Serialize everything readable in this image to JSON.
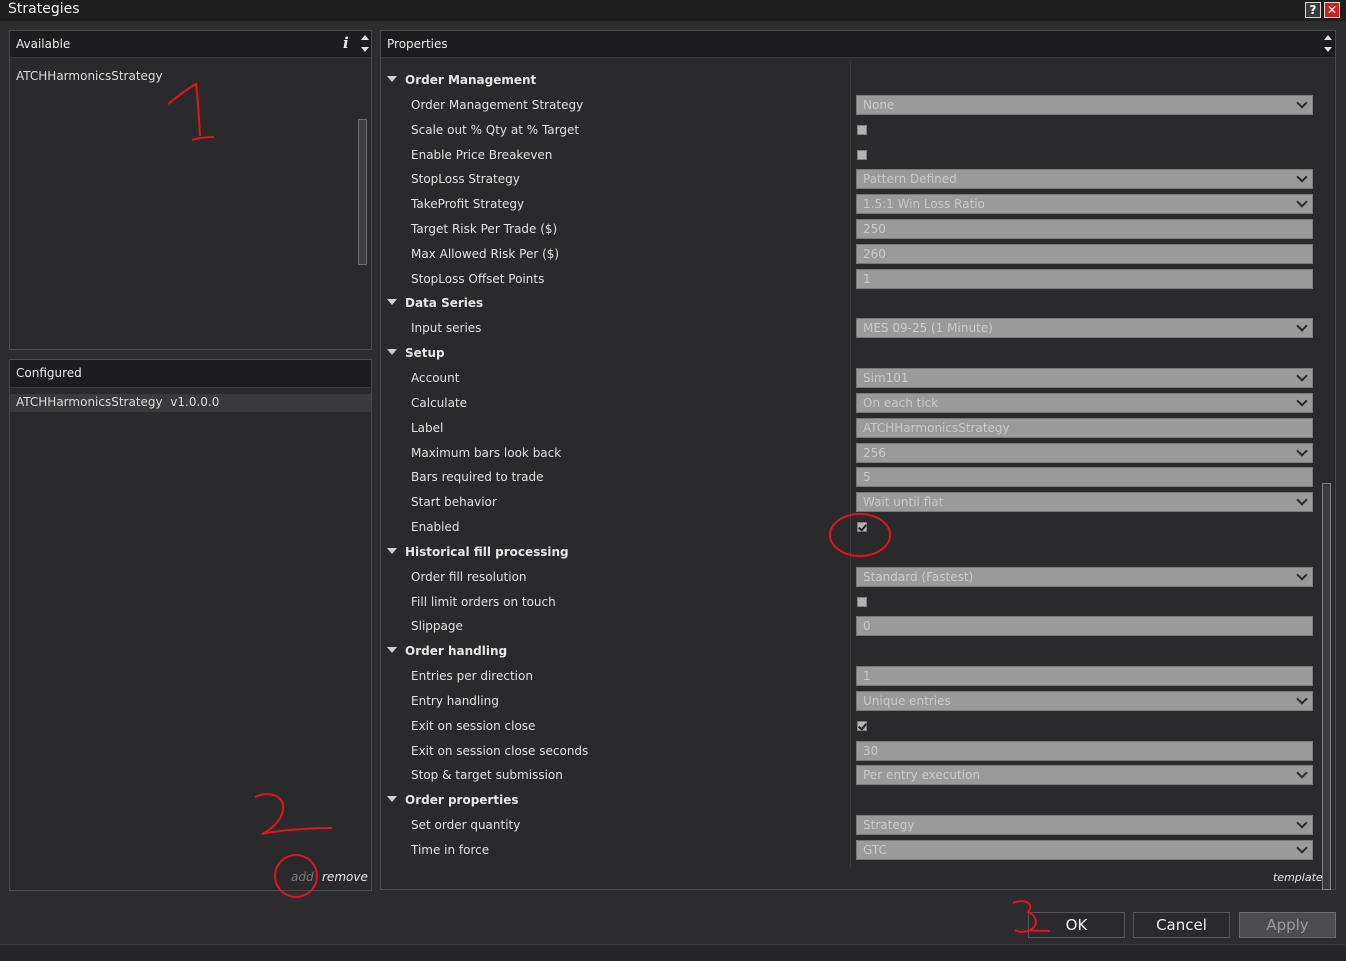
{
  "window": {
    "title": "Strategies"
  },
  "available": {
    "header": "Available",
    "info_icon": "i",
    "items": [
      "ATCHHarmonicsStrategy"
    ]
  },
  "configured": {
    "header": "Configured",
    "items": [
      "ATCHHarmonicsStrategy  v1.0.0.0"
    ],
    "add_label": "add",
    "remove_label": "remove"
  },
  "properties": {
    "header": "Properties",
    "template_label": "template",
    "groups": [
      {
        "name": "Order Management",
        "rows": [
          {
            "label": "Order Management Strategy",
            "type": "select",
            "value": "None"
          },
          {
            "label": "Scale out % Qty at % Target",
            "type": "checkbox",
            "checked": false
          },
          {
            "label": "Enable Price Breakeven",
            "type": "checkbox",
            "checked": false
          },
          {
            "label": "StopLoss Strategy",
            "type": "select",
            "value": "Pattern Defined"
          },
          {
            "label": "TakeProfit Strategy",
            "type": "select",
            "value": "1.5:1 Win Loss Ratio"
          },
          {
            "label": "Target Risk Per Trade ($)",
            "type": "text",
            "value": "250"
          },
          {
            "label": "Max Allowed Risk Per ($)",
            "type": "text",
            "value": "260"
          },
          {
            "label": "StopLoss Offset Points",
            "type": "text",
            "value": "1"
          }
        ]
      },
      {
        "name": "Data Series",
        "rows": [
          {
            "label": "Input series",
            "type": "select",
            "value": "MES 09-25 (1 Minute)"
          }
        ]
      },
      {
        "name": "Setup",
        "rows": [
          {
            "label": "Account",
            "type": "select",
            "value": "Sim101"
          },
          {
            "label": "Calculate",
            "type": "select",
            "value": "On each tick"
          },
          {
            "label": "Label",
            "type": "text",
            "value": "ATCHHarmonicsStrategy"
          },
          {
            "label": "Maximum bars look back",
            "type": "select",
            "value": "256"
          },
          {
            "label": "Bars required to trade",
            "type": "text",
            "value": "5"
          },
          {
            "label": "Start behavior",
            "type": "select",
            "value": "Wait until flat"
          },
          {
            "label": "Enabled",
            "type": "checkbox",
            "checked": true
          }
        ]
      },
      {
        "name": "Historical fill processing",
        "rows": [
          {
            "label": "Order fill resolution",
            "type": "select",
            "value": "Standard (Fastest)"
          },
          {
            "label": "Fill limit orders on touch",
            "type": "checkbox",
            "checked": false
          },
          {
            "label": "Slippage",
            "type": "text",
            "value": "0"
          }
        ]
      },
      {
        "name": "Order handling",
        "rows": [
          {
            "label": "Entries per direction",
            "type": "text",
            "value": "1"
          },
          {
            "label": "Entry handling",
            "type": "select",
            "value": "Unique entries"
          },
          {
            "label": "Exit on session close",
            "type": "checkbox",
            "checked": true
          },
          {
            "label": "Exit on session close seconds",
            "type": "text",
            "value": "30"
          },
          {
            "label": "Stop & target submission",
            "type": "select",
            "value": "Per entry execution"
          }
        ]
      },
      {
        "name": "Order properties",
        "rows": [
          {
            "label": "Set order quantity",
            "type": "select",
            "value": "Strategy"
          },
          {
            "label": "Time in force",
            "type": "select",
            "value": "GTC"
          }
        ]
      }
    ]
  },
  "buttons": {
    "ok": "OK",
    "cancel": "Cancel",
    "apply": "Apply"
  },
  "annotations": {
    "one": "1",
    "two": "2",
    "three": "3"
  },
  "colors": {
    "background": "#2d2d30",
    "header": "#1d1d1f",
    "field": "#9a9a9a",
    "close": "#c8231e",
    "annotation": "#e0141e"
  }
}
